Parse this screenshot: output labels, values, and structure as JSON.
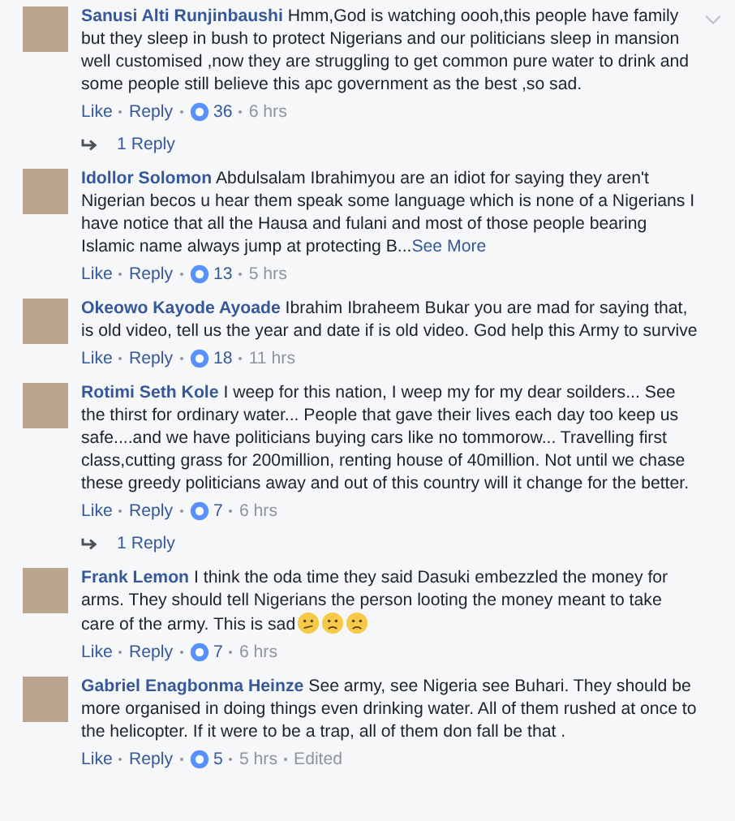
{
  "comments": [
    {
      "author": "Sanusi Alti Runjinbaushi",
      "text": "Hmm,God is watching oooh,this people have family but they sleep in bush to protect Nigerians and our politicians sleep in mansion well customised ,now they are struggling to get common pure water to drink and some people still believe this apc government as the best ,so sad.",
      "options_shown": true,
      "like": "Like",
      "reply": "Reply",
      "count": "36",
      "time": "6 hrs",
      "replies": "1 Reply"
    },
    {
      "author": "Idollor Solomon",
      "text": "Abdulsalam Ibrahimyou are an idiot for saying they aren't Nigerian becos u hear them speak some language which is none of a Nigerians I have notice that all the Hausa and fulani and most of those people bearing Islamic name always jump at protecting B...",
      "see_more": "See More",
      "like": "Like",
      "reply": "Reply",
      "count": "13",
      "time": "5 hrs"
    },
    {
      "author": "Okeowo Kayode Ayoade",
      "text": "Ibrahim Ibraheem Bukar you are mad for saying that, is old video, tell us the year and date if is old video. God help this Army to survive",
      "like": "Like",
      "reply": "Reply",
      "count": "18",
      "time": "11 hrs"
    },
    {
      "author": "Rotimi Seth Kole",
      "text": "I weep for this nation, I weep my for my dear soilders... See the thirst for ordinary water... People that gave their lives each day too keep us safe....and we have politicians buying cars like no tommorow... Travelling first class,cutting grass for 200million, renting house of 40million. Not until we chase these greedy politicians away and out of this country will it change for the better.",
      "like": "Like",
      "reply": "Reply",
      "count": "7",
      "time": "6 hrs",
      "replies": "1 Reply"
    },
    {
      "author": "Frank Lemon",
      "text": "I think the oda time they said Dasuki embezzled the money for arms. They should tell Nigerians the person looting the money meant to take care of the army. This is sad",
      "emojis": [
        {
          "kind": "confused"
        },
        {
          "kind": "sad"
        },
        {
          "kind": "sad"
        }
      ],
      "like": "Like",
      "reply": "Reply",
      "count": "7",
      "time": "6 hrs"
    },
    {
      "author": "Gabriel Enagbonma Heinze",
      "text": "See army, see Nigeria see Buhari. They should be more organised in doing things even drinking water. All of them rushed at once to the helicopter. If it were to be a trap, all of them don fall be that .",
      "like": "Like",
      "reply": "Reply",
      "count": "5",
      "time": "5 hrs",
      "edited": "Edited"
    }
  ]
}
